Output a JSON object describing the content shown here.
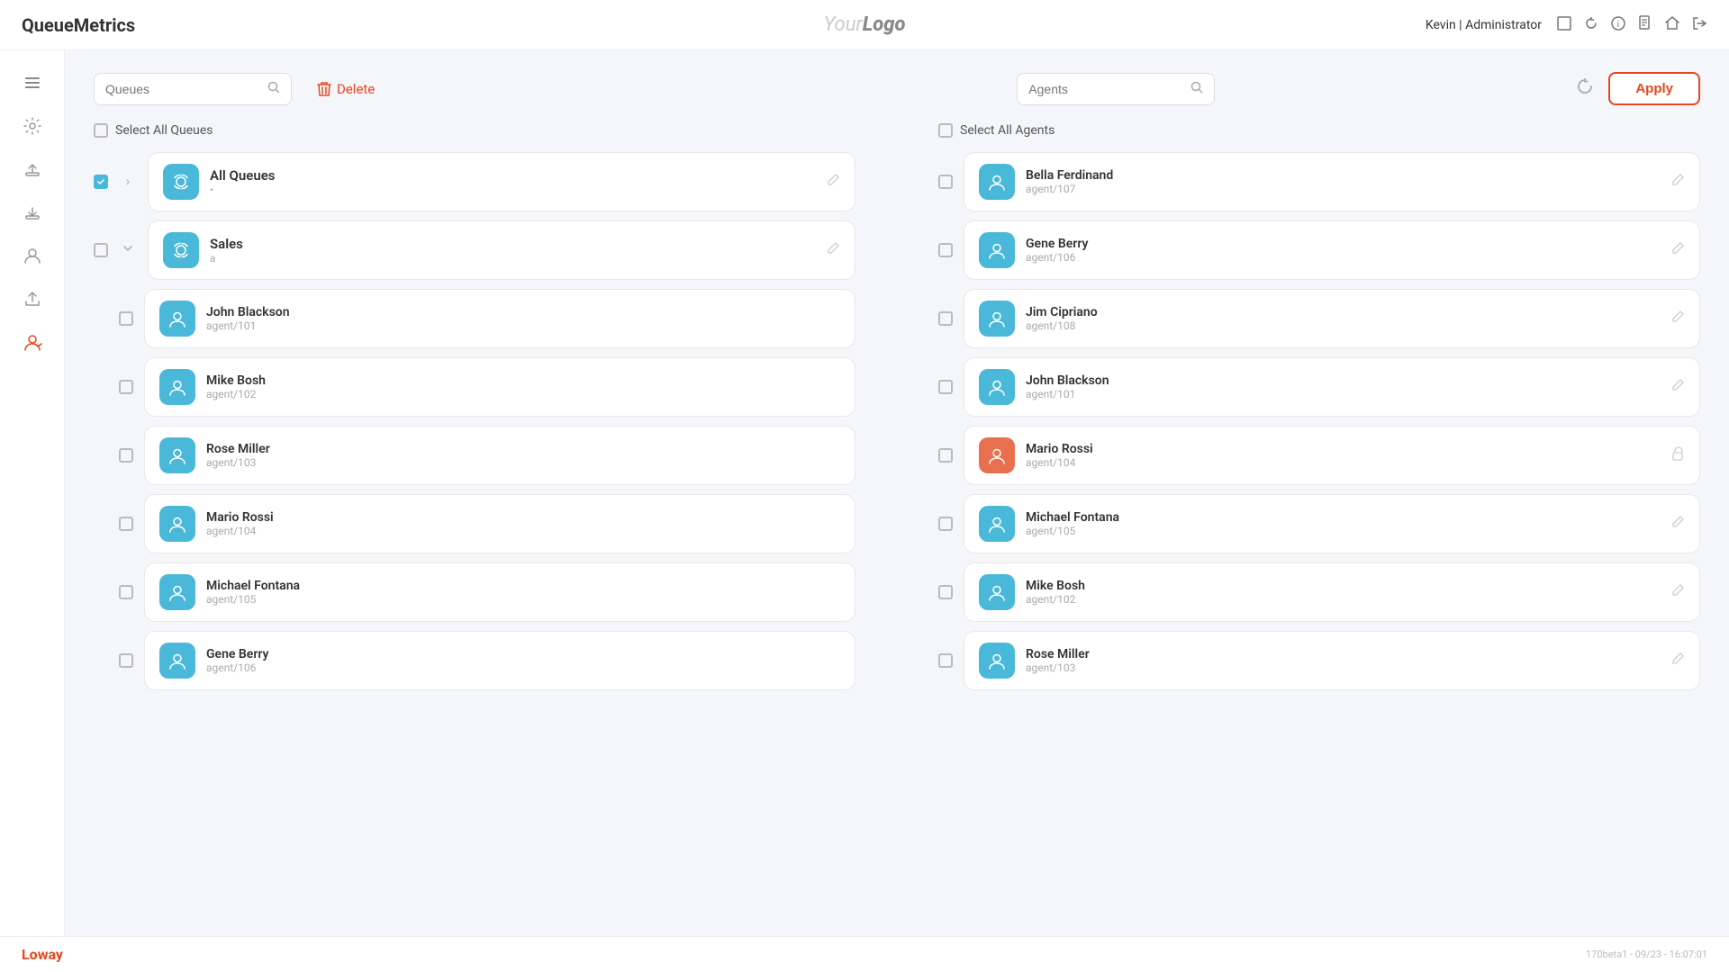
{
  "header": {
    "logo_qm": "Queue",
    "logo_qm2": "Metrics",
    "logo_center": "Your Logo",
    "user": "Kevin",
    "role": "Administrator",
    "icons": [
      "window-icon",
      "refresh-icon",
      "info-icon",
      "document-icon",
      "home-icon",
      "logout-icon"
    ]
  },
  "sidebar": {
    "menu_icon": "☰",
    "items": [
      {
        "name": "settings-icon",
        "symbol": "⚙"
      },
      {
        "name": "upload-icon",
        "symbol": "↑"
      },
      {
        "name": "download-icon",
        "symbol": "↓"
      },
      {
        "name": "user-icon",
        "symbol": "👤"
      },
      {
        "name": "export-icon",
        "symbol": "⬇"
      },
      {
        "name": "agent-icon",
        "symbol": "🖱"
      }
    ]
  },
  "toolbar": {
    "queues_placeholder": "Queues",
    "agents_placeholder": "Agents",
    "delete_label": "Delete",
    "apply_label": "Apply"
  },
  "queues_panel": {
    "select_all_label": "Select All Queues",
    "items": [
      {
        "id": "all-queues",
        "name": "All Queues",
        "sub": "•",
        "selected": true,
        "expanded": false,
        "agents": []
      },
      {
        "id": "sales",
        "name": "Sales",
        "sub": "a",
        "selected": false,
        "expanded": true,
        "agents": [
          {
            "name": "John Blackson",
            "code": "agent/101"
          },
          {
            "name": "Mike Bosh",
            "code": "agent/102"
          },
          {
            "name": "Rose Miller",
            "code": "agent/103"
          },
          {
            "name": "Mario Rossi",
            "code": "agent/104"
          },
          {
            "name": "Michael Fontana",
            "code": "agent/105"
          },
          {
            "name": "Gene Berry",
            "code": "agent/106"
          }
        ]
      }
    ]
  },
  "agents_panel": {
    "select_all_label": "Select All Agents",
    "items": [
      {
        "name": "Bella Ferdinand",
        "code": "agent/107",
        "avatar_color": "blue",
        "icon_type": "edit"
      },
      {
        "name": "Gene Berry",
        "code": "agent/106",
        "avatar_color": "blue",
        "icon_type": "edit"
      },
      {
        "name": "Jim Cipriano",
        "code": "agent/108",
        "avatar_color": "blue",
        "icon_type": "edit"
      },
      {
        "name": "John Blackson",
        "code": "agent/101",
        "avatar_color": "blue",
        "icon_type": "edit"
      },
      {
        "name": "Mario Rossi",
        "code": "agent/104",
        "avatar_color": "orange",
        "icon_type": "lock"
      },
      {
        "name": "Michael Fontana",
        "code": "agent/105",
        "avatar_color": "blue",
        "icon_type": "edit"
      },
      {
        "name": "Mike Bosh",
        "code": "agent/102",
        "avatar_color": "blue",
        "icon_type": "edit"
      },
      {
        "name": "Rose Miller",
        "code": "agent/103",
        "avatar_color": "blue",
        "icon_type": "edit"
      }
    ]
  },
  "footer": {
    "logo": "Loway",
    "version": "170beta1 - 09/23 - 16:07:01"
  }
}
